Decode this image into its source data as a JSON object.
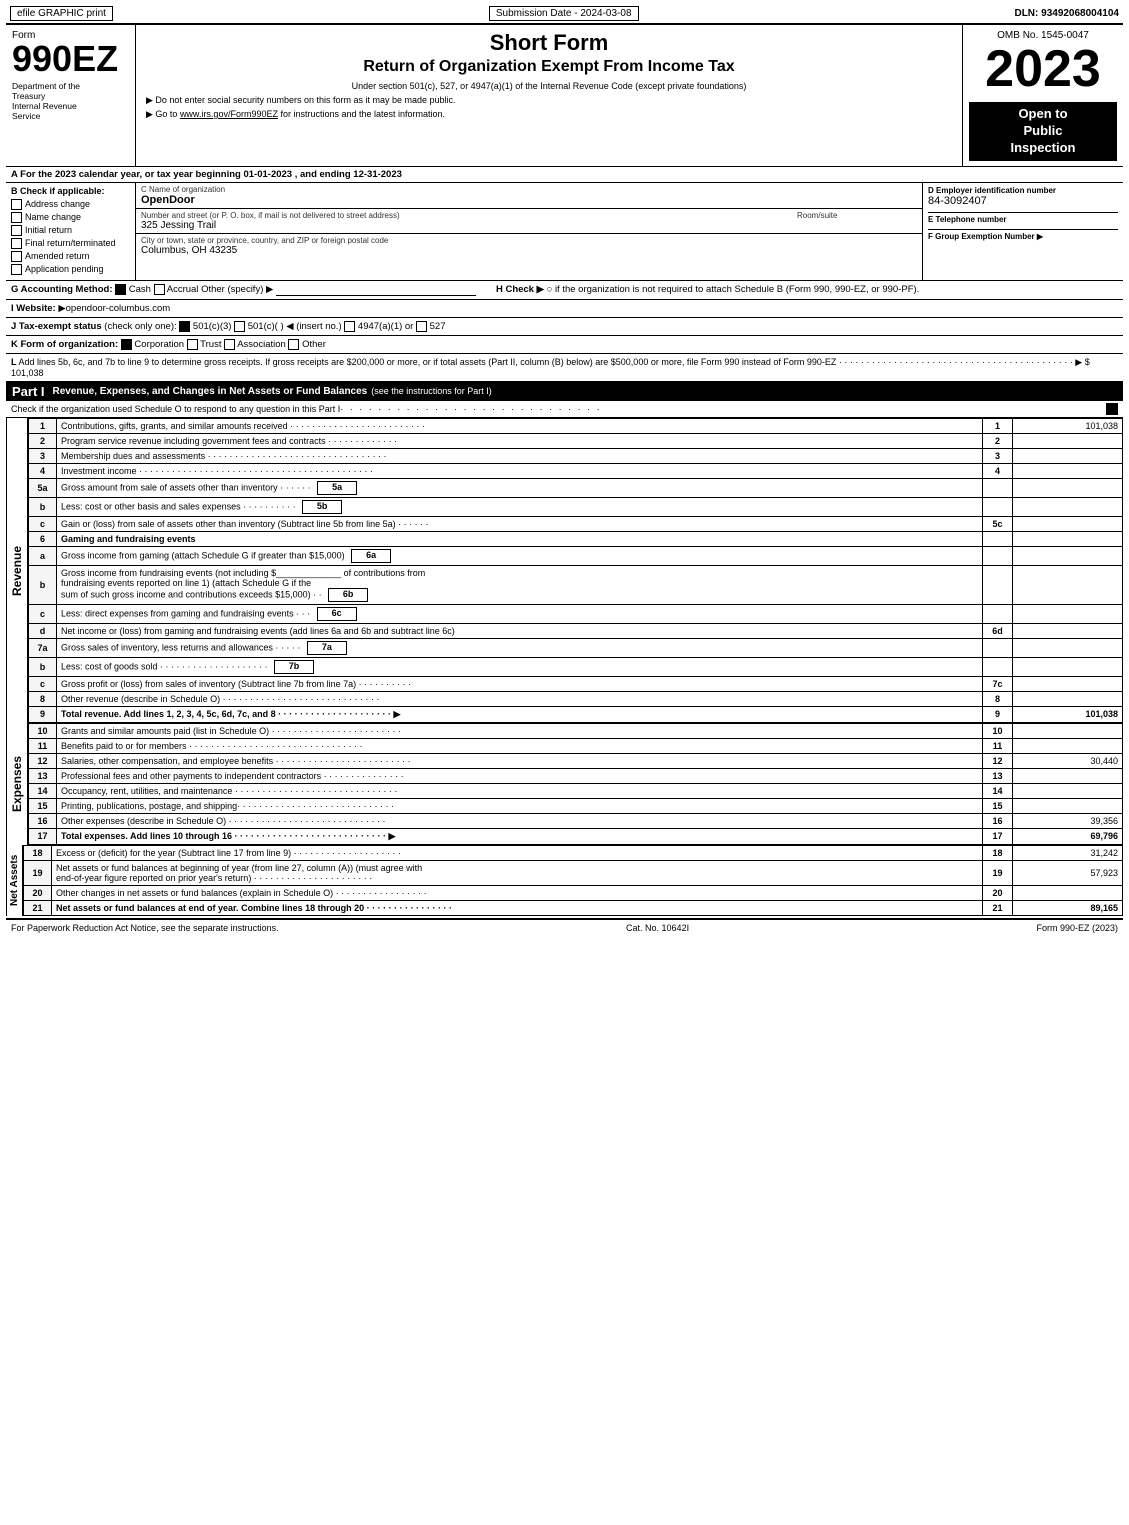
{
  "topBar": {
    "left": "efile GRAPHIC print",
    "submission": "Submission Date - 2024-03-08",
    "dln": "DLN: 93492068004104"
  },
  "formHeader": {
    "formId": "Form",
    "form990ez": "990EZ",
    "deptLine1": "Department of the",
    "deptLine2": "Treasury",
    "deptLine3": "Internal Revenue",
    "deptLine4": "Service",
    "shortForm": "Short Form",
    "returnTitle": "Return of Organization Exempt From Income Tax",
    "underSection": "Under section 501(c), 527, or 4947(a)(1) of the Internal Revenue Code (except private foundations)",
    "doNotEnter": "▶ Do not enter social security numbers on this form as it may be made public.",
    "goTo": "▶ Go to www.irs.gov/Form990EZ for instructions and the latest information.",
    "ombNo": "OMB No. 1545-0047",
    "year": "2023",
    "openPublic": "Open to Public Inspection"
  },
  "sectionA": {
    "label": "A For the 2023 calendar year, or tax year beginning 01-01-2023 , and ending 12-31-2023",
    "checkLabel": "B Check if applicable:",
    "checks": [
      {
        "id": "address-change",
        "label": "Address change",
        "checked": false
      },
      {
        "id": "name-change",
        "label": "Name change",
        "checked": false
      },
      {
        "id": "initial-return",
        "label": "Initial return",
        "checked": false
      },
      {
        "id": "final-return",
        "label": "Final return/terminated",
        "checked": false
      },
      {
        "id": "amended-return",
        "label": "Amended return",
        "checked": false
      },
      {
        "id": "app-pending",
        "label": "Application pending",
        "checked": false
      }
    ],
    "orgNameLabel": "C Name of organization",
    "orgName": "OpenDoor",
    "streetLabel": "Number and street (or P. O. box, if mail is not delivered to street address)",
    "street": "325 Jessing Trail",
    "roomSuiteLabel": "Room/suite",
    "cityLabel": "City or town, state or province, country, and ZIP or foreign postal code",
    "city": "Columbus, OH  43235",
    "employerIdLabel": "D Employer identification number",
    "employerId": "84-3092407",
    "phoneLabel": "E Telephone number",
    "groupExemptLabel": "F Group Exemption Number",
    "groupExempt": "▶"
  },
  "sectionG": {
    "label": "G Accounting Method:",
    "cashChecked": true,
    "cashLabel": "Cash",
    "accrualChecked": false,
    "accrualLabel": "Accrual",
    "otherLabel": "Other (specify) ▶",
    "otherLine": "___________________________",
    "hLabel": "H Check ▶",
    "hText": "○ if the organization is not required to attach Schedule B (Form 990, 990-EZ, or 990-PF)."
  },
  "sectionI": {
    "label": "I Website: ▶opendoor-columbus.com"
  },
  "sectionJ": {
    "label": "J Tax-exempt status (check only one):",
    "options": "☑ 501(c)(3)  ○ 501(c)(   ) ◀ (insert no.)  ○ 4947(a)(1) or  ○ 527"
  },
  "sectionK": {
    "label": "K Form of organization:",
    "corpChecked": true,
    "corp": "Corporation",
    "trust": "Trust",
    "assoc": "Association",
    "other": "Other"
  },
  "sectionL": {
    "text": "L Add lines 5b, 6c, and 7b to line 9 to determine gross receipts. If gross receipts are $200,000 or more, or if total assets (Part II, column (B) below) are $500,000 or more, file Form 990 instead of Form 990-EZ",
    "dots": "· · · · · · · · · · · · · · · · · · · · · · · · · · · · · · · · · · · · · · · · ·",
    "arrow": "▶ $",
    "value": "101,038"
  },
  "partI": {
    "label": "Part I",
    "title": "Revenue, Expenses, and Changes in Net Assets or Fund Balances",
    "seeInstructions": "(see the instructions for Part I)",
    "checkSchedule": "Check if the organization used Schedule O to respond to any question in this Part I",
    "checkDots": "· · · · · · · · · · · · · · · · · · · · · · · · · · · ·",
    "checkBox": "☑",
    "rows": [
      {
        "num": "1",
        "desc": "Contributions, gifts, grants, and similar amounts received",
        "dots": "· · · · · · · · · · · · · · · · · · · · · · · · ·",
        "lineNum": "1",
        "value": "101,038"
      },
      {
        "num": "2",
        "desc": "Program service revenue including government fees and contracts",
        "dots": "· · · · · · · · · · · · · ·",
        "lineNum": "2",
        "value": ""
      },
      {
        "num": "3",
        "desc": "Membership dues and assessments",
        "dots": "· · · · · · · · · · · · · · · · · · · · · · · · · · · · · · · · ·",
        "lineNum": "3",
        "value": ""
      },
      {
        "num": "4",
        "desc": "Investment income",
        "dots": "· · · · · · · · · · · · · · · · · · · · · · · · · · · · · · · · · · · · · · · · · · ·",
        "lineNum": "4",
        "value": ""
      },
      {
        "num": "5a",
        "desc": "Gross amount from sale of assets other than inventory · · · · · ·",
        "lineNum": "5a",
        "value": ""
      },
      {
        "num": "b",
        "desc": "Less: cost or other basis and sales expenses · · · · · · · · · ·",
        "lineNum": "5b",
        "value": ""
      },
      {
        "num": "c",
        "desc": "Gain or (loss) from sale of assets other than inventory (Subtract line 5b from line 5a) · · · · · ·",
        "lineNum": "5c",
        "value": ""
      },
      {
        "num": "6",
        "desc": "Gaming and fundraising events",
        "lineNum": "",
        "value": "",
        "noLine": true
      },
      {
        "num": "a",
        "desc": "Gross income from gaming (attach Schedule G if greater than $15,000)",
        "lineNum": "6a",
        "value": ""
      },
      {
        "num": "b",
        "desc": "Gross income from fundraising events (not including $_____________ of contributions from fundraising events reported on line 1) (attach Schedule G if the sum of such gross income and contributions exceeds $15,000) · ·",
        "lineNum": "6b",
        "value": ""
      },
      {
        "num": "c",
        "desc": "Less: direct expenses from gaming and fundraising events · · ·",
        "lineNum": "6c",
        "value": ""
      },
      {
        "num": "d",
        "desc": "Net income or (loss) from gaming and fundraising events (add lines 6a and 6b and subtract line 6c)",
        "lineNum": "6d",
        "value": ""
      },
      {
        "num": "7a",
        "desc": "Gross sales of inventory, less returns and allowances · · · · ·",
        "lineNum": "7a",
        "value": ""
      },
      {
        "num": "b",
        "desc": "Less: cost of goods sold · · · · · · · · · · · · · · · · · · · ·",
        "lineNum": "7b",
        "value": ""
      },
      {
        "num": "c",
        "desc": "Gross profit or (loss) from sales of inventory (Subtract line 7b from line 7a) · · · · · · · · · ·",
        "lineNum": "7c",
        "value": ""
      },
      {
        "num": "8",
        "desc": "Other revenue (describe in Schedule O)",
        "dots": "· · · · · · · · · · · · · · · · · · · · · · · · · · · · ·",
        "lineNum": "8",
        "value": ""
      },
      {
        "num": "9",
        "desc": "Total revenue. Add lines 1, 2, 3, 4, 5c, 6d, 7c, and 8",
        "dots": "· · · · · · · · · · · · · · · · · · · · ·",
        "arrow": "▶",
        "lineNum": "9",
        "value": "101,038",
        "bold": true
      }
    ],
    "expenseRows": [
      {
        "num": "10",
        "desc": "Grants and similar amounts paid (list in Schedule O)",
        "dots": "· · · · · · · · · · · · · · · · · · · · · · · ·",
        "lineNum": "10",
        "value": ""
      },
      {
        "num": "11",
        "desc": "Benefits paid to or for members",
        "dots": "· · · · · · · · · · · · · · · · · · · · · · · · · · · · · · · ·",
        "lineNum": "11",
        "value": ""
      },
      {
        "num": "12",
        "desc": "Salaries, other compensation, and employee benefits",
        "dots": "· · · · · · · · · · · · · · · · · · · · · · · · ·",
        "lineNum": "12",
        "value": "30,440"
      },
      {
        "num": "13",
        "desc": "Professional fees and other payments to independent contractors",
        "dots": "· · · · · · · · · · · · · · ·",
        "lineNum": "13",
        "value": ""
      },
      {
        "num": "14",
        "desc": "Occupancy, rent, utilities, and maintenance",
        "dots": "· · · · · · · · · · · · · · · · · · · · · · · · · · · · · · · ·",
        "lineNum": "14",
        "value": ""
      },
      {
        "num": "15",
        "desc": "Printing, publications, postage, and shipping·",
        "dots": "· · · · · · · · · · · · · · · · · · · · · · · · · · · ·",
        "lineNum": "15",
        "value": ""
      },
      {
        "num": "16",
        "desc": "Other expenses (describe in Schedule O)",
        "dots": "· · · · · · · · · · · · · · · · · · · · · · · · · · · · ·",
        "lineNum": "16",
        "value": "39,356"
      },
      {
        "num": "17",
        "desc": "Total expenses. Add lines 10 through 16",
        "dots": "· · · · · · · · · · · · · · · · · · · · · · · · · · · ·",
        "arrow": "▶",
        "lineNum": "17",
        "value": "69,796",
        "bold": true
      }
    ],
    "netAssetRows": [
      {
        "num": "18",
        "desc": "Excess or (deficit) for the year (Subtract line 17 from line 9)",
        "dots": "· · · · · · · · · · · · · · · · · · · ·",
        "lineNum": "18",
        "value": "31,242"
      },
      {
        "num": "19",
        "desc": "Net assets or fund balances at beginning of year (from line 27, column (A)) (must agree with end-of-year figure reported on prior year's return)",
        "dots": "· · · · · · · · · · · · · · · · · · · · ·",
        "lineNum": "19",
        "value": "57,923"
      },
      {
        "num": "20",
        "desc": "Other changes in net assets or fund balances (explain in Schedule O)",
        "dots": "· · · · · · · · · · · · · · · · · ·",
        "lineNum": "20",
        "value": ""
      },
      {
        "num": "21",
        "desc": "Net assets or fund balances at end of year. Combine lines 18 through 20",
        "dots": "· · · · · · · · · · · · · · · · ·",
        "lineNum": "21",
        "value": "89,165",
        "bold": true
      }
    ]
  },
  "footer": {
    "paperwork": "For Paperwork Reduction Act Notice, see the separate instructions.",
    "cat": "Cat. No. 10642I",
    "formRef": "Form 990-EZ (2023)"
  }
}
